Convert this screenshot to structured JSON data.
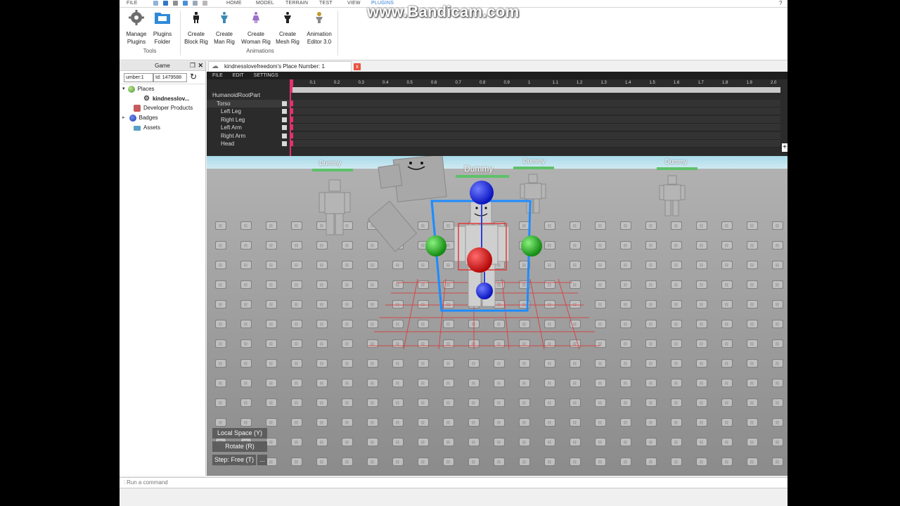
{
  "watermark": "www.Bandicam.com",
  "menu": {
    "file": "FILE",
    "tabs": [
      "HOME",
      "MODEL",
      "TERRAIN",
      "TEST",
      "VIEW",
      "PLUGINS"
    ]
  },
  "ribbon": {
    "buttons": [
      {
        "l1": "Manage",
        "l2": "Plugins"
      },
      {
        "l1": "Plugins",
        "l2": "Folder"
      },
      {
        "l1": "Create",
        "l2": "Block Rig"
      },
      {
        "l1": "Create",
        "l2": "Man Rig"
      },
      {
        "l1": "Create",
        "l2": "Woman Rig"
      },
      {
        "l1": "Create",
        "l2": "Mesh Rig"
      },
      {
        "l1": "Animation",
        "l2": "Editor 3.0"
      }
    ],
    "groups": {
      "tools": "Tools",
      "animations": "Animations"
    }
  },
  "explorer": {
    "title": "Game",
    "search_left": "umber:1",
    "search_right": "Id: 1479588",
    "items": [
      "Places",
      "kindnesslov...",
      "Developer Products",
      "Badges",
      "Assets"
    ]
  },
  "tab": {
    "label": "kindnesslovefreedom's Place Number: 1",
    "close": "x"
  },
  "anim": {
    "menu": [
      "FILE",
      "EDIT",
      "SETTINGS"
    ],
    "ticks": [
      "0",
      "0.1",
      "0.2",
      "0.3",
      "0.4",
      "0.5",
      "0.6",
      "0.7",
      "0.8",
      "0.9",
      "1",
      "1.1",
      "1.2",
      "1.3",
      "1.4",
      "1.5",
      "1.6",
      "1.7",
      "1.8",
      "1.9",
      "2.0"
    ],
    "root": "HumanoidRootPart",
    "parts": [
      "Torso",
      "Left Leg",
      "Right Leg",
      "Left Arm",
      "Right Arm",
      "Head"
    ]
  },
  "viewport": {
    "dummy": "Dummy",
    "hud": [
      "Local Space (Y)",
      "Rotate (R)",
      "Step: Free (T)"
    ],
    "hud_more": "..."
  },
  "command": {
    "placeholder": "Run a command"
  }
}
